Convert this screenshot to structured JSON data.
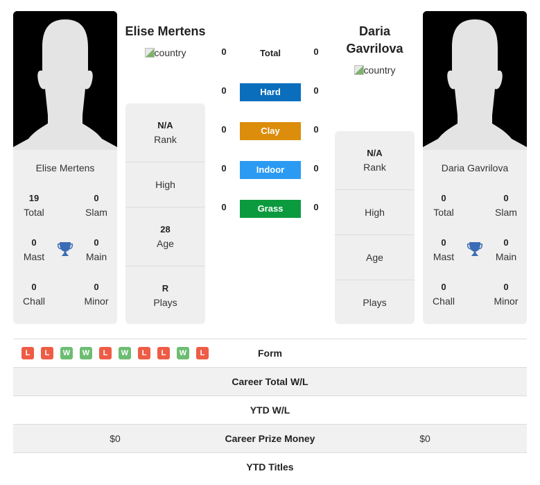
{
  "player1": {
    "name": "Elise Mertens",
    "country_alt": "country",
    "titles": {
      "total": {
        "value": "19",
        "label": "Total"
      },
      "slam": {
        "value": "0",
        "label": "Slam"
      },
      "mast": {
        "value": "0",
        "label": "Mast"
      },
      "main": {
        "value": "0",
        "label": "Main"
      },
      "chall": {
        "value": "0",
        "label": "Chall"
      },
      "minor": {
        "value": "0",
        "label": "Minor"
      }
    },
    "info": {
      "rank": {
        "value": "N/A",
        "label": "Rank"
      },
      "high": {
        "value": "",
        "label": "High"
      },
      "age": {
        "value": "28",
        "label": "Age"
      },
      "plays": {
        "value": "R",
        "label": "Plays"
      }
    },
    "form": [
      "L",
      "L",
      "W",
      "W",
      "L",
      "W",
      "L",
      "L",
      "W",
      "L"
    ],
    "career_total_wl": "",
    "ytd_wl": "",
    "career_prize_money": "$0",
    "ytd_titles": ""
  },
  "player2": {
    "name_line1": "Daria",
    "name_line2": "Gavrilova",
    "name": "Daria Gavrilova",
    "country_alt": "country",
    "titles": {
      "total": {
        "value": "0",
        "label": "Total"
      },
      "slam": {
        "value": "0",
        "label": "Slam"
      },
      "mast": {
        "value": "0",
        "label": "Mast"
      },
      "main": {
        "value": "0",
        "label": "Main"
      },
      "chall": {
        "value": "0",
        "label": "Chall"
      },
      "minor": {
        "value": "0",
        "label": "Minor"
      }
    },
    "info": {
      "rank": {
        "value": "N/A",
        "label": "Rank"
      },
      "high": {
        "value": "",
        "label": "High"
      },
      "age": {
        "value": "",
        "label": "Age"
      },
      "plays": {
        "value": "",
        "label": "Plays"
      }
    },
    "career_total_wl": "",
    "ytd_wl": "",
    "career_prize_money": "$0",
    "ytd_titles": ""
  },
  "h2h": [
    {
      "label": "Total",
      "p1": "0",
      "p2": "0",
      "color": null
    },
    {
      "label": "Hard",
      "p1": "0",
      "p2": "0",
      "color": "#0a6ebd"
    },
    {
      "label": "Clay",
      "p1": "0",
      "p2": "0",
      "color": "#dc8d0b"
    },
    {
      "label": "Indoor",
      "p1": "0",
      "p2": "0",
      "color": "#2b9af3"
    },
    {
      "label": "Grass",
      "p1": "0",
      "p2": "0",
      "color": "#0c9a3e"
    }
  ],
  "table": {
    "form_label": "Form",
    "career_total_wl_label": "Career Total W/L",
    "ytd_wl_label": "YTD W/L",
    "career_prize_money_label": "Career Prize Money",
    "ytd_titles_label": "YTD Titles"
  },
  "colors": {
    "win": "#6cbd72",
    "loss": "#ee5c45",
    "trophy": "#3b6db5"
  },
  "icons": {
    "avatar": "person-silhouette-icon",
    "trophy": "trophy-icon",
    "flag": "broken-image-icon"
  }
}
